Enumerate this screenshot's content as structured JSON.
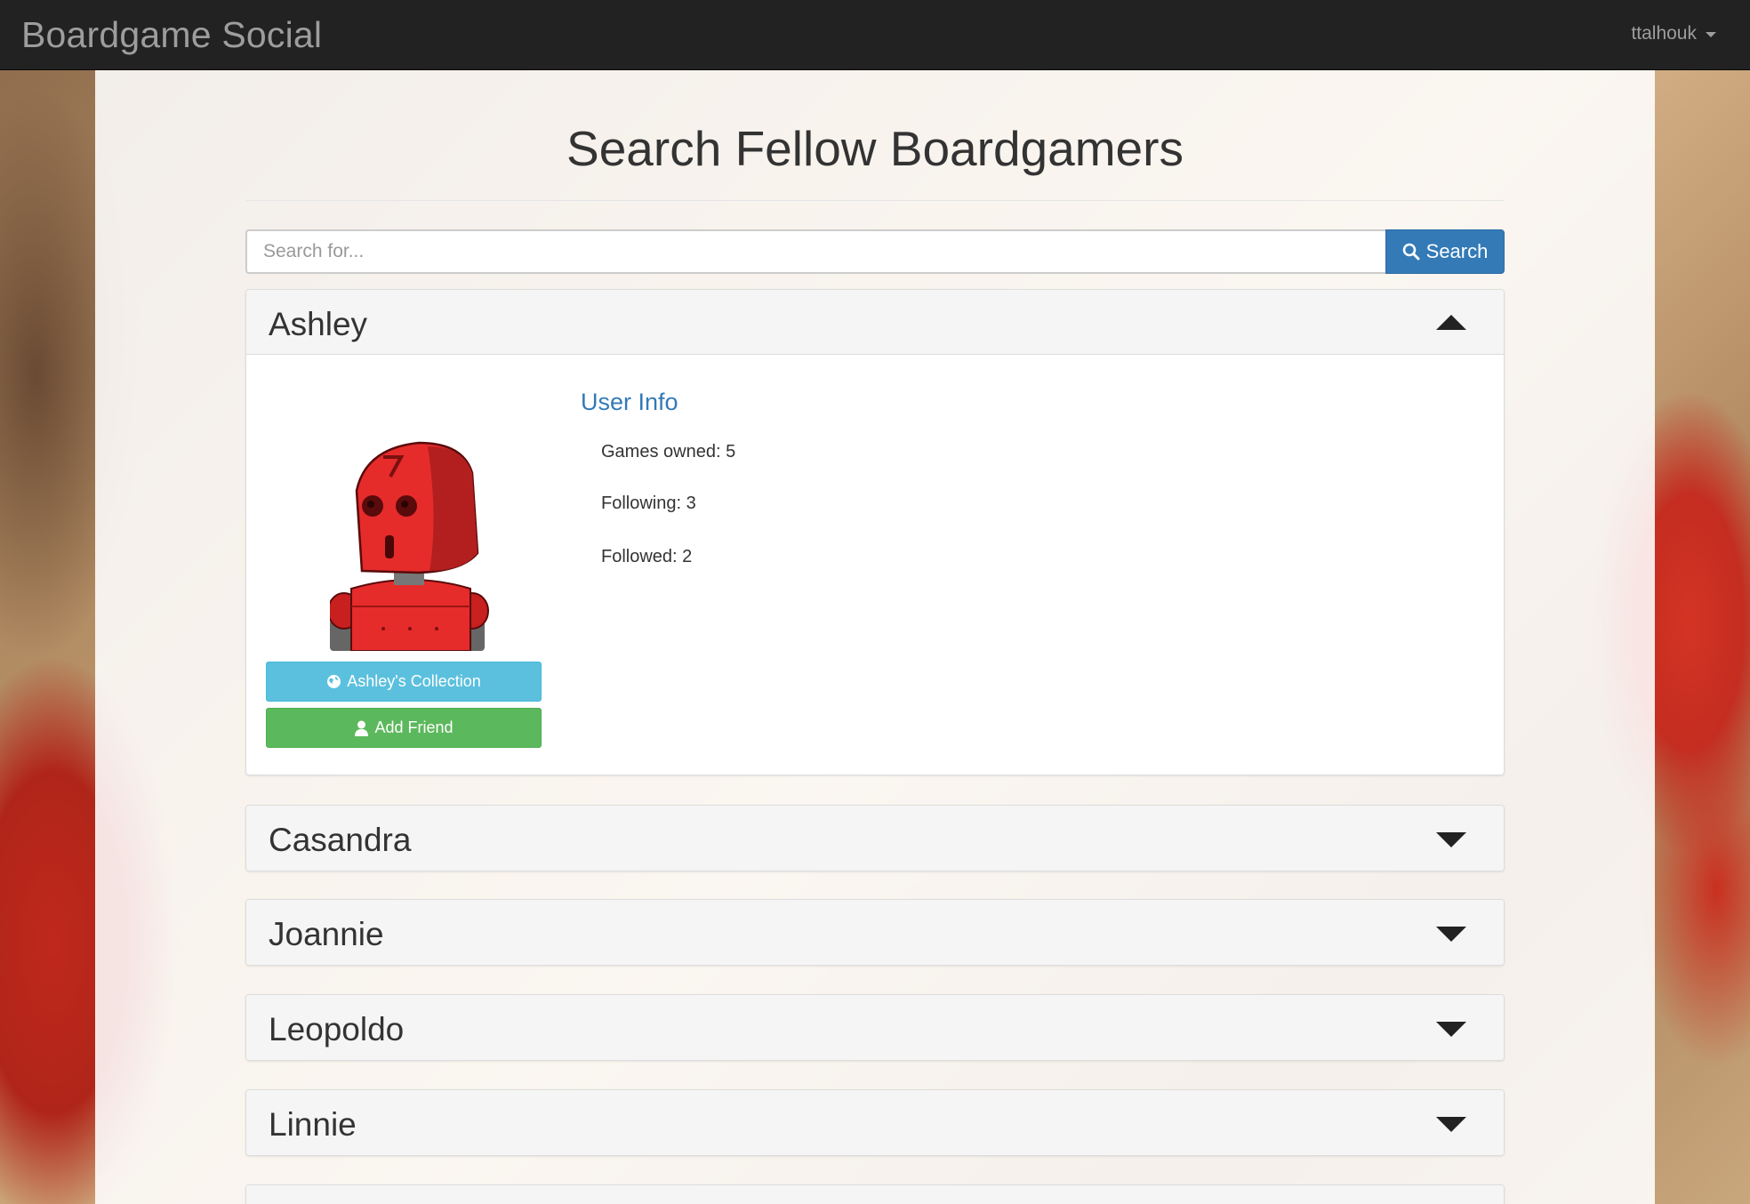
{
  "navbar": {
    "brand": "Boardgame Social",
    "user": "ttalhouk"
  },
  "page": {
    "title": "Search Fellow Boardgamers"
  },
  "search": {
    "placeholder": "Search for...",
    "value": "",
    "button_label": "Search"
  },
  "users": [
    {
      "name": "Ashley",
      "expanded": true,
      "info_title": "User Info",
      "games_owned": "Games owned: 5",
      "following": "Following: 3",
      "followed": "Followed: 2",
      "collection_button": "Ashley's Collection",
      "add_friend_button": "Add Friend"
    },
    {
      "name": "Casandra",
      "expanded": false
    },
    {
      "name": "Joannie",
      "expanded": false
    },
    {
      "name": "Leopoldo",
      "expanded": false
    },
    {
      "name": "Linnie",
      "expanded": false
    }
  ],
  "icons": {
    "search": "search-icon",
    "collection": "globe-icon",
    "add_friend": "user-icon",
    "expand": "triangle-down-icon",
    "collapse": "triangle-up-icon",
    "user_menu": "caret-down-icon"
  },
  "colors": {
    "navbar": "#222222",
    "primary": "#337ab7",
    "info": "#5bc0de",
    "success": "#5cb85c",
    "avatar_robot": "#e62b2b"
  }
}
